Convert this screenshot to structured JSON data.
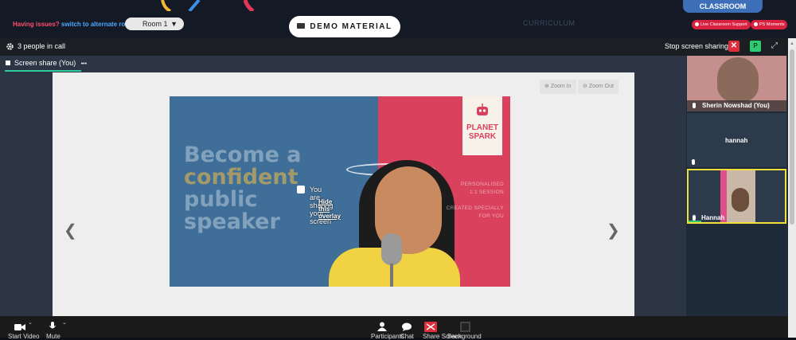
{
  "topbar": {
    "classroom_tab": "CLASSROOM",
    "issues_question": "Having issues?",
    "issues_link": "switch to alternate room",
    "room_value": "Room 1",
    "demo_button": "DEMO MATERIAL",
    "curriculum": "CURRICULUM",
    "live_support": "Live Classroom Support",
    "ps_moments": "PS Moments"
  },
  "zoom": {
    "people_count": "3 people in call",
    "stop_sharing": "Stop screen sharing",
    "stop_icon": "✕",
    "participant_initial": "P",
    "share_tab": "Screen share (You)",
    "tab_more": "•••"
  },
  "document": {
    "zoom_in": "Zoom In",
    "zoom_out": "Zoom Out"
  },
  "slide": {
    "line1": "Become a",
    "line2": "confident",
    "line3": "public",
    "line4": "speaker",
    "logo_line1": "PLANET",
    "logo_line2": "SPARK",
    "tag1": "PERSONALISED",
    "tag2": "1:1 SESSION",
    "tag3": "CREATED SPECIALLY",
    "tag4": "FOR YOU"
  },
  "overlay": {
    "sharing_text": "You are sharing your screen",
    "hide_link": "Hide this overlay"
  },
  "participants": [
    {
      "name": "Sherin Nowshad (You)"
    },
    {
      "name": "hannah"
    },
    {
      "name": "Hannah"
    }
  ],
  "bottombar": {
    "start_video": "Start Video",
    "mute": "Mute",
    "participants": "Participants",
    "chat": "Chat",
    "share_screen": "Share Screen",
    "background": "Background"
  },
  "colors": {
    "accent_red": "#d9213f",
    "accent_blue": "#3c6fb8",
    "share_green": "#2ecc9a",
    "active_speaker": "#f2df3b"
  }
}
